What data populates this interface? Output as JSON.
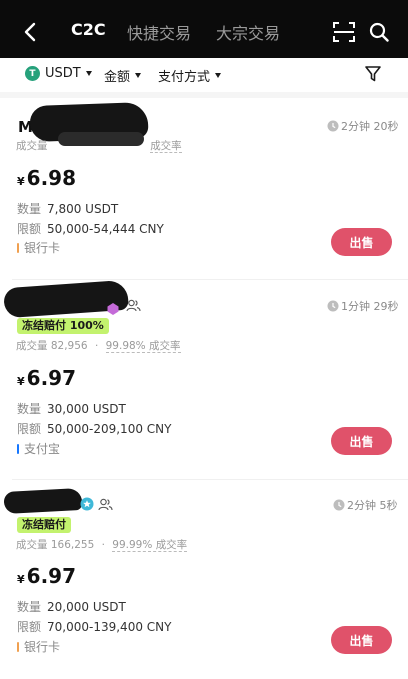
{
  "nav": {
    "tabs": [
      {
        "label": "C2C",
        "active": true
      },
      {
        "label": "快捷交易",
        "active": false
      },
      {
        "label": "大宗交易",
        "active": false
      }
    ]
  },
  "filters": {
    "coin": "USDT",
    "amount": "金额",
    "payment": "支付方式"
  },
  "colors": {
    "accent_sell": "#e0526a",
    "badge_green": "#c3f26e",
    "bank_card": "#f0a050",
    "alipay": "#1677ff"
  },
  "listings": [
    {
      "merchant_name": "M",
      "time": "2分钟 20秒",
      "badge": "",
      "volume_label": "成交量",
      "volume": "",
      "completion_rate": "",
      "rate_label": "成交率",
      "currency": "¥",
      "price": "6.98",
      "quantity_label": "数量",
      "quantity": "7,800 USDT",
      "limit_label": "限额",
      "limit": "50,000-54,444 CNY",
      "payment_method": "银行卡",
      "action": "出售"
    },
    {
      "merchant_name": "",
      "time": "1分钟 29秒",
      "badge": "冻结赔付 100%",
      "volume_label": "成交量",
      "volume": "82,956",
      "completion_rate": "99.98%",
      "rate_label": "成交率",
      "currency": "¥",
      "price": "6.97",
      "quantity_label": "数量",
      "quantity": "30,000 USDT",
      "limit_label": "限额",
      "limit": "50,000-209,100 CNY",
      "payment_method": "支付宝",
      "action": "出售"
    },
    {
      "merchant_name": "",
      "time": "2分钟 5秒",
      "badge": "冻结赔付",
      "volume_label": "成交量",
      "volume": "166,255",
      "completion_rate": "99.99%",
      "rate_label": "成交率",
      "currency": "¥",
      "price": "6.97",
      "quantity_label": "数量",
      "quantity": "20,000 USDT",
      "limit_label": "限额",
      "limit": "70,000-139,400 CNY",
      "payment_method": "银行卡",
      "action": "出售"
    }
  ]
}
